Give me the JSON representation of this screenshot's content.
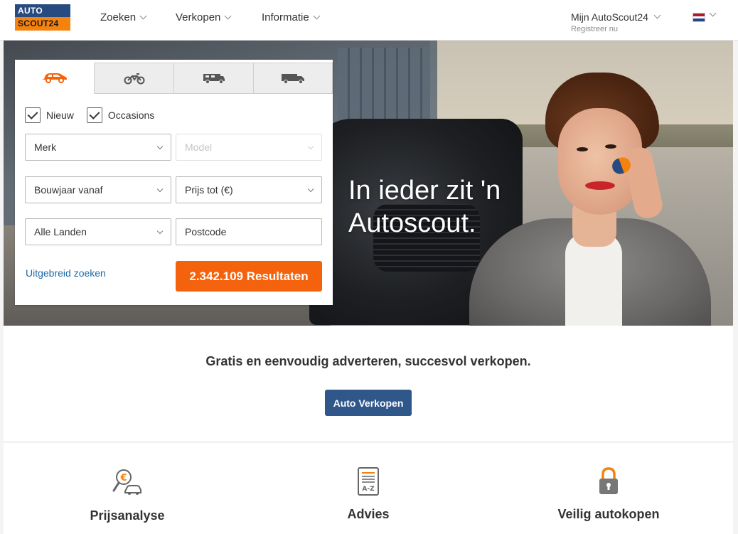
{
  "header": {
    "logo": {
      "line1": "AUTO",
      "line2": "SCOUT24"
    },
    "nav": [
      {
        "label": "Zoeken"
      },
      {
        "label": "Verkopen"
      },
      {
        "label": "Informatie"
      }
    ],
    "account": {
      "label": "Mijn AutoScout24",
      "sublabel": "Registreer nu"
    },
    "language_flag": "nl-flag-icon"
  },
  "hero": {
    "slogan_line1": "In ieder zit 'n",
    "slogan_line2": "Autoscout."
  },
  "search": {
    "tabs": [
      {
        "icon": "car-icon",
        "active": true
      },
      {
        "icon": "motorbike-icon",
        "active": false
      },
      {
        "icon": "camper-icon",
        "active": false
      },
      {
        "icon": "truck-icon",
        "active": false
      }
    ],
    "checkboxes": [
      {
        "label": "Nieuw",
        "checked": true
      },
      {
        "label": "Occasions",
        "checked": true
      }
    ],
    "fields": {
      "make": "Merk",
      "model": "Model",
      "year_from": "Bouwjaar vanaf",
      "price_to": "Prijs tot (€)",
      "country": "Alle Landen",
      "postcode_placeholder": "Postcode"
    },
    "advanced_link": "Uitgebreid zoeken",
    "results_button": "2.342.109 Resultaten"
  },
  "sell": {
    "text": "Gratis en eenvoudig adverteren, succesvol verkopen.",
    "button": "Auto Verkopen"
  },
  "features": [
    {
      "icon": "price-analysis-icon",
      "label": "Prijsanalyse"
    },
    {
      "icon": "advice-document-icon",
      "label": "Advies"
    },
    {
      "icon": "padlock-icon",
      "label": "Veilig autokopen"
    }
  ],
  "colors": {
    "brand_blue": "#274a80",
    "brand_orange": "#f5820d",
    "cta_orange": "#f5620d",
    "sell_button": "#2f5789",
    "link": "#1e6aa8"
  }
}
